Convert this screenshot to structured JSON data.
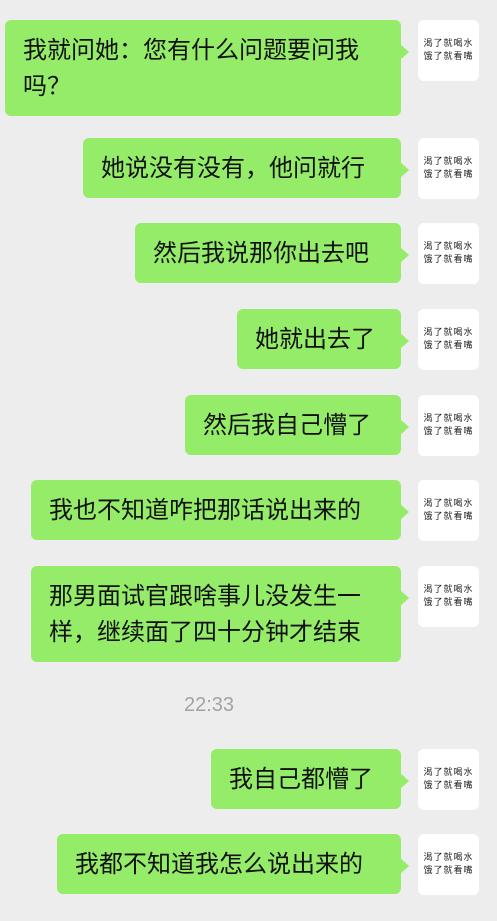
{
  "avatar": {
    "line1": "渴了就喝水",
    "line2": "饿了就看嘴"
  },
  "timestamp": "22:33",
  "messages": [
    {
      "text": "我就问她：您有什么问题要问我吗？"
    },
    {
      "text": "她说没有没有，他问就行"
    },
    {
      "text": "然后我说那你出去吧"
    },
    {
      "text": "她就出去了"
    },
    {
      "text": "然后我自己懵了"
    },
    {
      "text": "我也不知道咋把那话说出来的"
    },
    {
      "text": "那男面试官跟啥事儿没发生一样，继续面了四十分钟才结束"
    },
    {
      "text": "我自己都懵了"
    },
    {
      "text": "我都不知道我怎么说出来的"
    }
  ]
}
